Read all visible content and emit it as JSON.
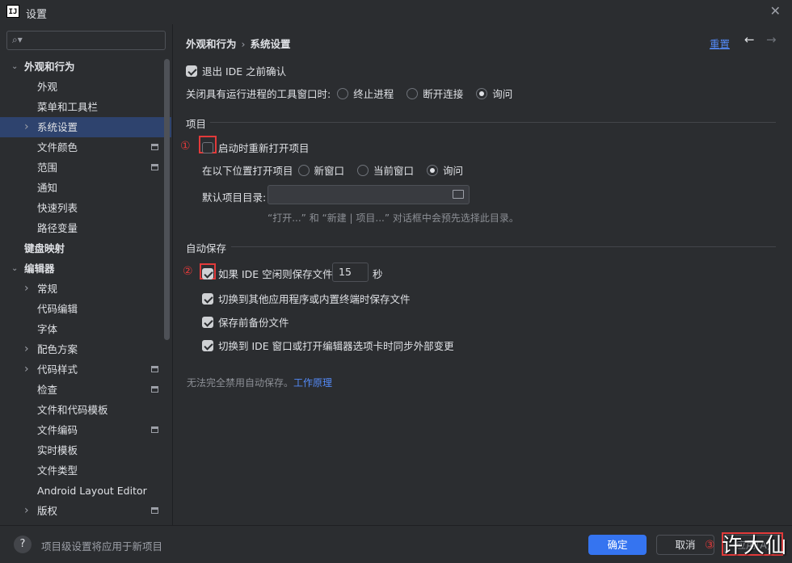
{
  "window": {
    "title": "设置",
    "logo": "IJ"
  },
  "search": {
    "placeholder": ""
  },
  "sidebar": {
    "items": [
      {
        "label": "外观和行为",
        "level": 0,
        "expanded": true,
        "bold": true
      },
      {
        "label": "外观",
        "level": 1
      },
      {
        "label": "菜单和工具栏",
        "level": 1
      },
      {
        "label": "系统设置",
        "level": 1,
        "arrow": true,
        "selected": true
      },
      {
        "label": "文件颜色",
        "level": 1,
        "badge": true
      },
      {
        "label": "范围",
        "level": 1,
        "badge": true
      },
      {
        "label": "通知",
        "level": 1
      },
      {
        "label": "快速列表",
        "level": 1
      },
      {
        "label": "路径变量",
        "level": 1
      },
      {
        "label": "键盘映射",
        "level": 0,
        "bold": true
      },
      {
        "label": "编辑器",
        "level": 0,
        "expanded": true,
        "bold": true
      },
      {
        "label": "常规",
        "level": 1,
        "arrow": true
      },
      {
        "label": "代码编辑",
        "level": 1
      },
      {
        "label": "字体",
        "level": 1
      },
      {
        "label": "配色方案",
        "level": 1,
        "arrow": true
      },
      {
        "label": "代码样式",
        "level": 1,
        "arrow": true,
        "badge": true
      },
      {
        "label": "检查",
        "level": 1,
        "badge": true
      },
      {
        "label": "文件和代码模板",
        "level": 1
      },
      {
        "label": "文件编码",
        "level": 1,
        "badge": true
      },
      {
        "label": "实时模板",
        "level": 1
      },
      {
        "label": "文件类型",
        "level": 1
      },
      {
        "label": "Android Layout Editor",
        "level": 1
      },
      {
        "label": "版权",
        "level": 1,
        "arrow": true,
        "badge": true
      }
    ]
  },
  "header": {
    "breadcrumb_parent": "外观和行为",
    "breadcrumb_sep": "›",
    "breadcrumb_current": "系统设置",
    "reset_label": "重置"
  },
  "general": {
    "confirm_exit_label": "退出 IDE 之前确认",
    "close_with_process_label": "关闭具有运行进程的工具窗口时:",
    "close_options": [
      "终止进程",
      "断开连接",
      "询问"
    ]
  },
  "project": {
    "section_title": "项目",
    "reopen_label": "启动时重新打开项目",
    "open_location_label": "在以下位置打开项目",
    "open_options": [
      "新窗口",
      "当前窗口",
      "询问"
    ],
    "default_dir_label": "默认项目目录:",
    "default_dir_value": "",
    "hint": "“打开...” 和 “新建 | 项目...” 对话框中会预先选择此目录。"
  },
  "autosave": {
    "section_title": "自动保存",
    "idle_label": "如果 IDE 空闲则保存文件",
    "idle_seconds": "15",
    "seconds_unit": "秒",
    "switch_app_label": "切换到其他应用程序或内置终端时保存文件",
    "backup_label": "保存前备份文件",
    "sync_label": "切换到 IDE 窗口或打开编辑器选项卡时同步外部变更",
    "note": "无法完全禁用自动保存。",
    "note_link": "工作原理"
  },
  "annotations": {
    "marker1": "①",
    "marker2": "②",
    "marker3": "③"
  },
  "footer": {
    "note": "项目级设置将应用于新项目",
    "ok_label": "确定",
    "cancel_label": "取消",
    "apply_label": "应用(A)",
    "watermark": "许大仙"
  },
  "colors": {
    "accent": "#3574f0",
    "link": "#548af7",
    "selection": "#2e436e",
    "annotation": "#e23a3a"
  }
}
